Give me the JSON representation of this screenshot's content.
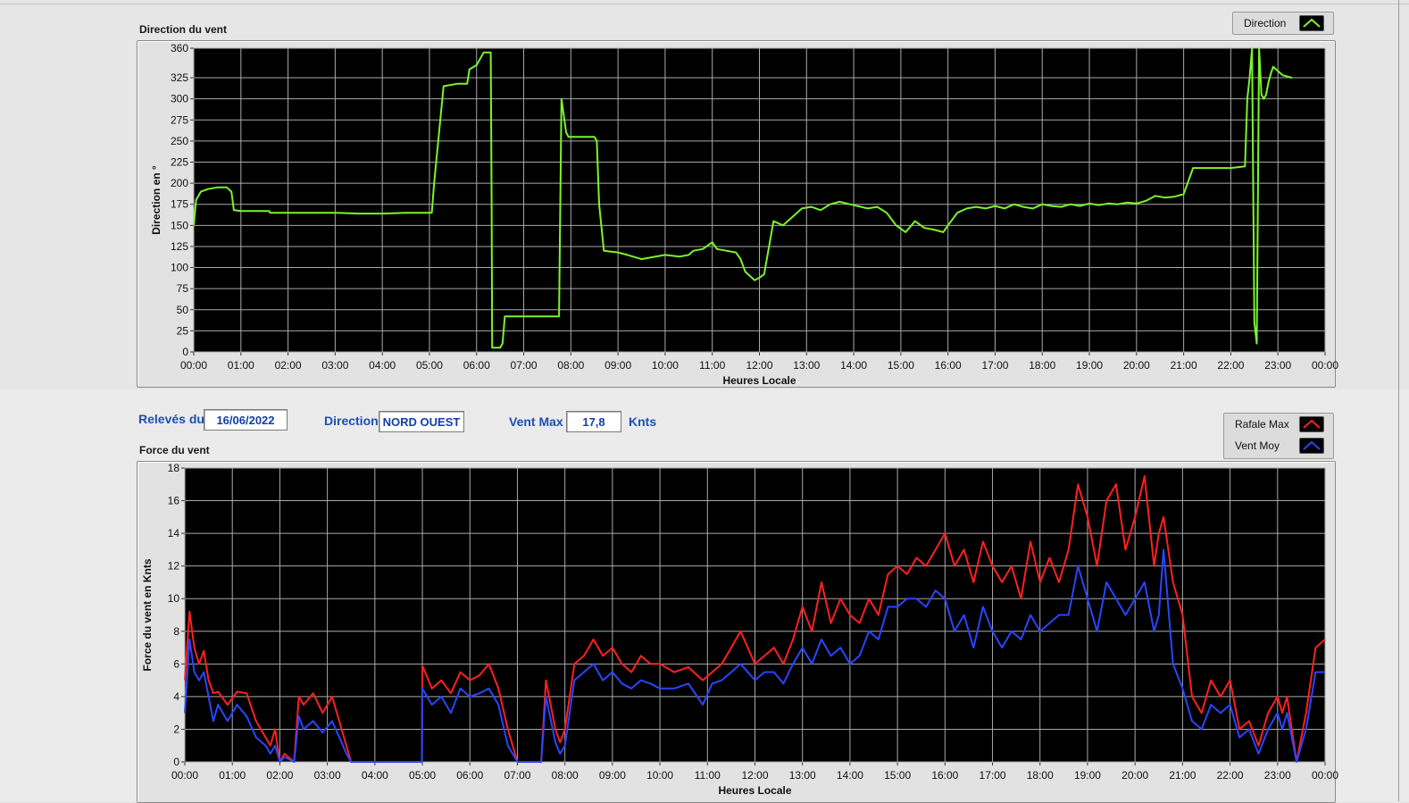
{
  "charts": {
    "direction": {
      "title": "Direction du vent",
      "legend": [
        {
          "label": "Direction",
          "color": "#7bf52a"
        }
      ]
    },
    "force": {
      "title": "Force du vent",
      "legend": [
        {
          "label": "Rafale Max",
          "color": "#ff2020"
        },
        {
          "label": "Vent Moy",
          "color": "#2a45ff"
        }
      ]
    }
  },
  "info": {
    "date_label": "Relevés du",
    "date_value": "16/06/2022",
    "direction_label": "Direction",
    "direction_value": "NORD OUEST",
    "ventmax_label": "Vent Max",
    "ventmax_value": "17,8",
    "unit": "Knts"
  },
  "chart_data": [
    {
      "type": "line",
      "title": "Direction du vent",
      "xlabel": "Heures Locale",
      "ylabel": "Direction en °",
      "xticks": [
        "00:00",
        "01:00",
        "02:00",
        "03:00",
        "04:00",
        "05:00",
        "06:00",
        "07:00",
        "08:00",
        "09:00",
        "10:00",
        "11:00",
        "12:00",
        "13:00",
        "14:00",
        "15:00",
        "16:00",
        "17:00",
        "18:00",
        "19:00",
        "20:00",
        "21:00",
        "22:00",
        "23:00",
        "00:00"
      ],
      "yticks": [
        0,
        25,
        50,
        75,
        100,
        125,
        150,
        175,
        200,
        225,
        250,
        275,
        300,
        325,
        360
      ],
      "ylim": [
        0,
        360
      ],
      "xlim_hours": [
        0,
        24
      ],
      "grid": true,
      "legend": "top-right",
      "series": [
        {
          "name": "Direction",
          "color": "#7bf52a",
          "x_hours": [
            0,
            0.05,
            0.15,
            0.3,
            0.5,
            0.7,
            0.8,
            0.85,
            1.0,
            1.3,
            1.6,
            1.62,
            2.0,
            2.5,
            3.0,
            3.5,
            4.0,
            4.5,
            4.9,
            5.0,
            5.05,
            5.1,
            5.3,
            5.6,
            5.8,
            5.85,
            6.0,
            6.15,
            6.3,
            6.32,
            6.33,
            6.5,
            6.55,
            6.6,
            7.0,
            7.5,
            7.7,
            7.75,
            7.8,
            7.9,
            7.95,
            8.5,
            8.55,
            8.6,
            8.7,
            9.0,
            9.2,
            9.5,
            10.0,
            10.3,
            10.5,
            10.6,
            10.8,
            11.0,
            11.1,
            11.3,
            11.5,
            11.6,
            11.7,
            11.9,
            12.0,
            12.1,
            12.3,
            12.5,
            12.7,
            12.9,
            13.1,
            13.3,
            13.5,
            13.7,
            14.0,
            14.3,
            14.5,
            14.7,
            14.9,
            15.1,
            15.3,
            15.5,
            15.7,
            15.9,
            16.0,
            16.2,
            16.4,
            16.6,
            16.8,
            17.0,
            17.2,
            17.4,
            17.6,
            17.8,
            18.0,
            18.2,
            18.4,
            18.6,
            18.8,
            19.0,
            19.2,
            19.4,
            19.6,
            19.8,
            20.0,
            20.2,
            20.4,
            20.6,
            20.8,
            21.0,
            21.2,
            21.25,
            21.3,
            21.5,
            21.8,
            22.0,
            22.3,
            22.35,
            22.4,
            22.45,
            22.5,
            22.55,
            22.6,
            22.62,
            22.65,
            22.7,
            22.75,
            22.8,
            22.85,
            22.9,
            23.1,
            23.3,
            23.6,
            23.9,
            24.0
          ],
          "y": [
            150,
            180,
            190,
            193,
            195,
            195,
            190,
            168,
            167,
            167,
            167,
            165,
            165,
            165,
            165,
            164,
            164,
            165,
            165,
            165,
            165,
            200,
            315,
            318,
            318,
            335,
            340,
            355,
            355,
            175,
            5,
            5,
            10,
            42,
            42,
            42,
            42,
            42,
            300,
            260,
            255,
            255,
            250,
            175,
            120,
            118,
            115,
            110,
            115,
            113,
            115,
            120,
            122,
            130,
            122,
            120,
            118,
            110,
            95,
            85,
            88,
            92,
            155,
            150,
            160,
            170,
            172,
            168,
            175,
            178,
            174,
            170,
            172,
            165,
            150,
            142,
            155,
            147,
            145,
            142,
            150,
            165,
            170,
            172,
            170,
            173,
            170,
            175,
            172,
            170,
            175,
            173,
            172,
            175,
            173,
            176,
            174,
            176,
            175,
            177,
            176,
            179,
            185,
            183,
            184,
            187,
            218,
            218,
            218,
            218,
            218,
            218,
            220,
            300,
            325,
            360,
            35,
            10,
            360,
            340,
            305,
            300,
            305,
            320,
            330,
            338,
            328,
            325
          ]
        }
      ]
    },
    {
      "type": "line",
      "title": "Force du vent",
      "xlabel": "Heures Locale",
      "ylabel": "Force du vent en Knts",
      "xticks": [
        "00:00",
        "01:00",
        "02:00",
        "03:00",
        "04:00",
        "05:00",
        "06:00",
        "07:00",
        "08:00",
        "09:00",
        "10:00",
        "11:00",
        "12:00",
        "13:00",
        "14:00",
        "15:00",
        "16:00",
        "17:00",
        "18:00",
        "19:00",
        "20:00",
        "21:00",
        "22:00",
        "23:00",
        "00:00"
      ],
      "yticks": [
        0,
        2,
        4,
        6,
        8,
        10,
        12,
        14,
        16,
        18
      ],
      "ylim": [
        0,
        18
      ],
      "xlim_hours": [
        0,
        24
      ],
      "grid": true,
      "legend": "top-right",
      "series": [
        {
          "name": "Rafale Max",
          "color": "#ff2020",
          "x_hours": [
            0,
            0.1,
            0.2,
            0.3,
            0.4,
            0.5,
            0.6,
            0.7,
            0.9,
            1.1,
            1.3,
            1.5,
            1.7,
            1.8,
            1.9,
            2.0,
            2.1,
            2.3,
            2.4,
            2.5,
            2.7,
            2.9,
            3.1,
            3.3,
            3.4,
            3.5,
            4.0,
            4.5,
            4.99,
            5.0,
            5.2,
            5.4,
            5.6,
            5.8,
            6.0,
            6.2,
            6.4,
            6.6,
            6.8,
            7.0,
            7.1,
            7.5,
            7.6,
            7.8,
            7.9,
            8.0,
            8.2,
            8.4,
            8.6,
            8.8,
            9.0,
            9.2,
            9.4,
            9.6,
            9.8,
            10.0,
            10.3,
            10.6,
            10.9,
            11.1,
            11.3,
            11.5,
            11.7,
            12.0,
            12.2,
            12.4,
            12.6,
            12.8,
            13.0,
            13.2,
            13.4,
            13.6,
            13.8,
            14.0,
            14.2,
            14.4,
            14.6,
            14.8,
            15.0,
            15.2,
            15.4,
            15.6,
            15.8,
            16.0,
            16.2,
            16.4,
            16.6,
            16.8,
            17.0,
            17.2,
            17.4,
            17.6,
            17.8,
            18.0,
            18.2,
            18.4,
            18.6,
            18.8,
            19.0,
            19.2,
            19.4,
            19.6,
            19.8,
            20.0,
            20.2,
            20.4,
            20.5,
            20.6,
            20.8,
            21.0,
            21.2,
            21.4,
            21.6,
            21.8,
            22.0,
            22.2,
            22.4,
            22.6,
            22.8,
            23.0,
            23.1,
            23.2,
            23.4,
            23.6,
            23.8,
            24.0
          ],
          "y": [
            5,
            9.2,
            7,
            6,
            6.8,
            5,
            4.2,
            4.3,
            3.5,
            4.3,
            4.2,
            2.5,
            1.5,
            1,
            2,
            0,
            0.5,
            0,
            4,
            3.5,
            4.2,
            3,
            4,
            2,
            1,
            0,
            0,
            0,
            0,
            5.9,
            4.5,
            5,
            4.2,
            5.5,
            5,
            5.3,
            6,
            4.5,
            2,
            0,
            0,
            0,
            5,
            2,
            1.2,
            2,
            6,
            6.5,
            7.5,
            6.5,
            7,
            6,
            5.5,
            6.5,
            6,
            6,
            5.5,
            5.8,
            5,
            5.5,
            6,
            7,
            8,
            6,
            6.5,
            7,
            6,
            7.5,
            9.5,
            8,
            11,
            8.5,
            10,
            9,
            8.5,
            10,
            9,
            11.5,
            12,
            11.5,
            12.5,
            12,
            13,
            14,
            12,
            13,
            11,
            13.5,
            12,
            11,
            12,
            10,
            13.5,
            11,
            12.5,
            11,
            13,
            17,
            15,
            12,
            16,
            17,
            13,
            15,
            17.5,
            12,
            14,
            15,
            11,
            9,
            4,
            3,
            5,
            4,
            5,
            2,
            2.5,
            1,
            3,
            4,
            3,
            4,
            0,
            3,
            7,
            7.5,
            7,
            8
          ],
          "note": "approximate"
        },
        {
          "name": "Vent Moy",
          "color": "#2a45ff",
          "x_hours": [
            0,
            0.1,
            0.2,
            0.3,
            0.4,
            0.5,
            0.6,
            0.7,
            0.9,
            1.1,
            1.3,
            1.5,
            1.7,
            1.8,
            1.9,
            2.0,
            2.1,
            2.3,
            2.4,
            2.5,
            2.7,
            2.9,
            3.1,
            3.3,
            3.4,
            3.5,
            4.0,
            4.5,
            4.99,
            5.0,
            5.2,
            5.4,
            5.6,
            5.8,
            6.0,
            6.2,
            6.4,
            6.6,
            6.8,
            7.0,
            7.1,
            7.5,
            7.6,
            7.8,
            7.9,
            8.0,
            8.2,
            8.4,
            8.6,
            8.8,
            9.0,
            9.2,
            9.4,
            9.6,
            9.8,
            10.0,
            10.3,
            10.6,
            10.9,
            11.1,
            11.3,
            11.5,
            11.7,
            12.0,
            12.2,
            12.4,
            12.6,
            12.8,
            13.0,
            13.2,
            13.4,
            13.6,
            13.8,
            14.0,
            14.2,
            14.4,
            14.6,
            14.8,
            15.0,
            15.2,
            15.4,
            15.6,
            15.8,
            16.0,
            16.2,
            16.4,
            16.6,
            16.8,
            17.0,
            17.2,
            17.4,
            17.6,
            17.8,
            18.0,
            18.2,
            18.4,
            18.6,
            18.8,
            19.0,
            19.2,
            19.4,
            19.6,
            19.8,
            20.0,
            20.2,
            20.4,
            20.5,
            20.6,
            20.8,
            21.0,
            21.2,
            21.4,
            21.6,
            21.8,
            22.0,
            22.2,
            22.4,
            22.6,
            22.8,
            23.0,
            23.1,
            23.2,
            23.4,
            23.6,
            23.8,
            24.0
          ],
          "y": [
            3,
            7.5,
            5.5,
            5,
            5.5,
            4,
            2.5,
            3.5,
            2.5,
            3.5,
            2.8,
            1.5,
            1,
            0.5,
            1,
            0,
            0.3,
            0,
            2.8,
            2,
            2.5,
            1.8,
            2.5,
            1.2,
            0.5,
            0,
            0,
            0,
            0,
            4.5,
            3.5,
            4,
            3,
            4.5,
            4,
            4.2,
            4.5,
            3.5,
            1,
            0,
            0,
            0,
            4,
            1.2,
            0.5,
            1,
            5,
            5.5,
            6,
            5,
            5.5,
            4.8,
            4.5,
            5,
            4.8,
            4.5,
            4.5,
            4.8,
            3.5,
            4.8,
            5,
            5.5,
            6,
            5,
            5.5,
            5.5,
            4.8,
            6,
            7,
            6,
            7.5,
            6.5,
            7,
            6,
            6.5,
            8,
            7.5,
            9.5,
            9.5,
            10,
            10,
            9.5,
            10.5,
            10,
            8,
            9,
            7,
            9.5,
            8,
            7,
            8,
            7.5,
            9,
            8,
            8.5,
            9,
            9,
            12,
            10,
            8,
            11,
            10,
            9,
            10,
            11,
            8,
            9,
            13,
            6,
            4.5,
            2.5,
            2,
            3.5,
            3,
            3.5,
            1.5,
            2,
            0.5,
            2,
            3,
            2,
            3,
            0,
            2,
            5.5,
            5.5,
            6,
            7
          ],
          "note": "approximate"
        }
      ]
    }
  ]
}
